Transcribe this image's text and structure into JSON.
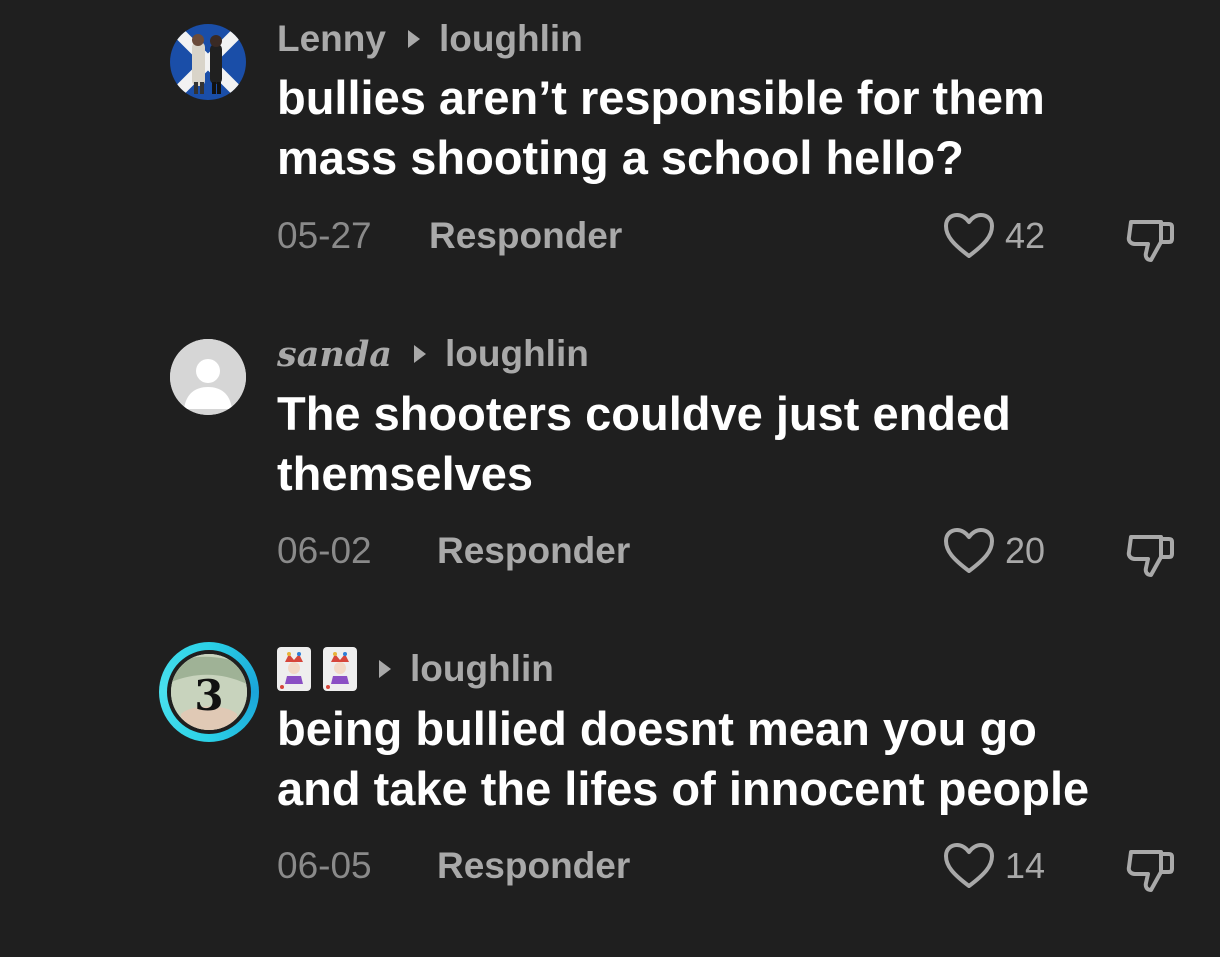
{
  "comments": [
    {
      "author": "Lenny",
      "reply_to": "loughlin",
      "text_lines": [
        "bullies aren’t responsible for them",
        "mass shooting a school hello?"
      ],
      "date": "05-27",
      "reply_label": "Responder",
      "likes": "42"
    },
    {
      "author": "sanda",
      "reply_to": "loughlin",
      "text_lines": [
        "The shooters couldve just ended",
        "themselves"
      ],
      "date": "06-02",
      "reply_label": "Responder",
      "likes": "20"
    },
    {
      "author": "🃏🃏",
      "reply_to": "loughlin",
      "text_lines": [
        "being bullied doesnt mean you go",
        "and take the lifes of innocent people"
      ],
      "date": "06-05",
      "reply_label": "Responder",
      "likes": "14"
    }
  ],
  "icons": {
    "reply_arrow": "triangle-right-icon",
    "like": "heart-outline-icon",
    "dislike": "thumbs-down-icon",
    "card": "joker-card-icon"
  },
  "colors": {
    "background": "#1f1f1f",
    "text": "#ffffff",
    "muted": "#a9a9a9",
    "date": "#8a8a8a",
    "story_ring": "#2bd1e6"
  }
}
